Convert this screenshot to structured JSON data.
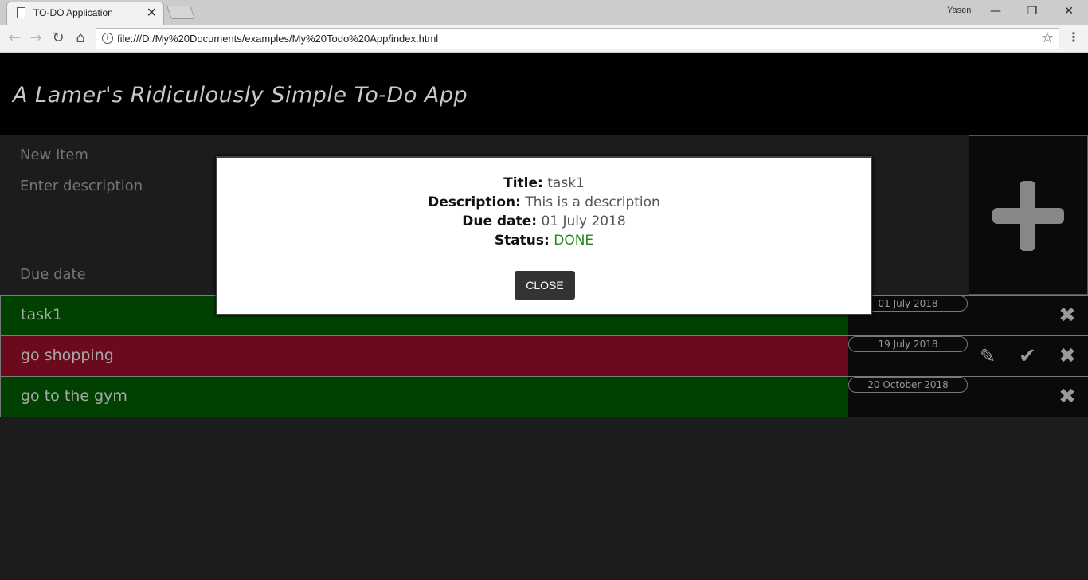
{
  "browser": {
    "tab_title": "TO-DO Application",
    "tab_close": "✕",
    "user": "Yasen",
    "url": "file:///D:/My%20Documents/examples/My%20Todo%20App/index.html",
    "window_controls": {
      "minimize": "—",
      "restore": "❐",
      "close": "✕"
    },
    "nav": {
      "back": "←",
      "forward": "→",
      "reload": "↻",
      "home": "⌂",
      "star": "☆",
      "menu": "⋮",
      "info": "i"
    }
  },
  "app": {
    "title": "A Lamer's Ridiculously Simple To-Do App",
    "form": {
      "title_placeholder": "New Item",
      "description_placeholder": "Enter description",
      "due_date_placeholder": "Due date"
    },
    "items": [
      {
        "title": "task1",
        "due": "01 July 2018",
        "status": "done",
        "color": "#004000"
      },
      {
        "title": "go shopping",
        "due": "19 July 2018",
        "status": "overdue",
        "color": "#6b0a1d"
      },
      {
        "title": "go to the gym",
        "due": "20 October 2018",
        "status": "done",
        "color": "#004000"
      }
    ],
    "icons": {
      "edit": "✎",
      "done": "✔",
      "delete": "✖"
    }
  },
  "modal": {
    "title_label": "Title:",
    "title_value": "task1",
    "description_label": "Description:",
    "description_value": "This is a description",
    "due_label": "Due date:",
    "due_value": "01 July 2018",
    "status_label": "Status:",
    "status_value": "DONE",
    "close_label": "CLOSE"
  }
}
